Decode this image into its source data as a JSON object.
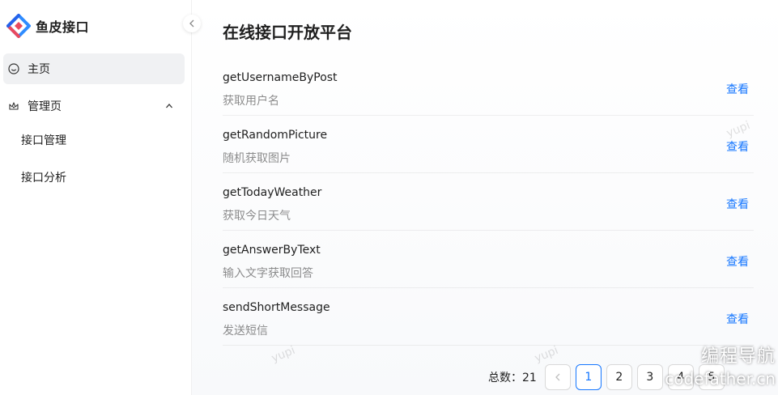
{
  "brand": {
    "name": "鱼皮接口",
    "logo_icon": "diamond-logo-icon"
  },
  "sidebar": {
    "items": [
      {
        "label": "主页",
        "icon": "smile-icon",
        "active": true
      },
      {
        "label": "管理页",
        "icon": "crown-icon",
        "expanded": true,
        "children": [
          {
            "label": "接口管理"
          },
          {
            "label": "接口分析"
          }
        ]
      }
    ]
  },
  "main": {
    "title": "在线接口开放平台",
    "apis": [
      {
        "name": "getUsernameByPost",
        "desc": "获取用户名",
        "action": "查看"
      },
      {
        "name": "getRandomPicture",
        "desc": "随机获取图片",
        "action": "查看"
      },
      {
        "name": "getTodayWeather",
        "desc": "获取今日天气",
        "action": "查看"
      },
      {
        "name": "getAnswerByText",
        "desc": "输入文字获取回答",
        "action": "查看"
      },
      {
        "name": "sendShortMessage",
        "desc": "发送短信",
        "action": "查看"
      }
    ],
    "pagination": {
      "total_label": "总数：21",
      "pages": [
        "1",
        "2",
        "3",
        "4",
        "5"
      ],
      "current": "1"
    }
  },
  "watermark": {
    "text": "yupi",
    "corner_line1": "编程导航",
    "corner_line2": "codefather.cn"
  },
  "colors": {
    "primary": "#1677ff",
    "sidebar_active_bg": "#f0f1f3"
  }
}
